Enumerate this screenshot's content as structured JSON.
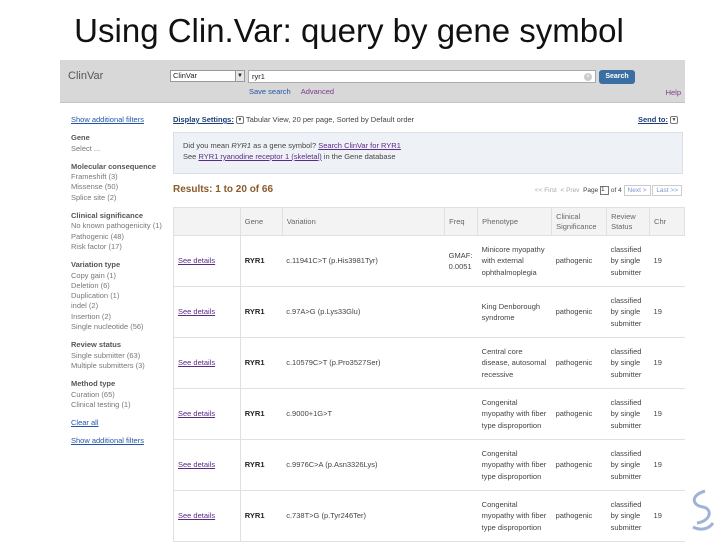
{
  "slide_title": "Using Clin.Var: query by gene symbol",
  "header": {
    "logo": "ClinVar",
    "db_select": "ClinVar",
    "search_value": "ryr1",
    "search_button": "Search",
    "save_search": "Save search",
    "advanced": "Advanced",
    "help": "Help"
  },
  "sidebar": {
    "show_filters_top": "Show additional filters",
    "groups": [
      {
        "title": "Gene",
        "items": [
          "Select ..."
        ]
      },
      {
        "title": "Molecular consequence",
        "items": [
          "Frameshift (3)",
          "Missense (50)",
          "Splice site (2)"
        ]
      },
      {
        "title": "Clinical significance",
        "items": [
          "No known pathogenicity (1)",
          "Pathogenic (48)",
          "Risk factor (17)"
        ]
      },
      {
        "title": "Variation type",
        "items": [
          "Copy gain (1)",
          "Deletion (6)",
          "Duplication (1)",
          "indel (2)",
          "Insertion (2)",
          "Single nucleotide (56)"
        ]
      },
      {
        "title": "Review status",
        "items": [
          "Single submitter (63)",
          "Multiple submitters (3)"
        ]
      },
      {
        "title": "Method type",
        "items": [
          "Curation (65)",
          "Clinical testing (1)"
        ]
      }
    ],
    "clear_all": "Clear all",
    "show_filters_bottom": "Show additional filters"
  },
  "display": {
    "label": "Display Settings:",
    "value": "Tabular View, 20 per page, Sorted by Default order",
    "send_to": "Send to:"
  },
  "suggest": {
    "line1_pre": "Did you mean ",
    "line1_term": "RYR1",
    "line1_mid": " as a gene symbol? ",
    "line1_link": "Search ClinVar for RYR1",
    "line2_pre": "See ",
    "line2_link": "RYR1 ryanodine receptor 1 (skeletal)",
    "line2_post": " in the Gene database"
  },
  "results": {
    "summary": "Results: 1 to 20 of 66",
    "first": "<< First",
    "prev": "< Prev",
    "page_label": "Page",
    "page": "1",
    "of": "of 4",
    "next": "Next >",
    "last": "Last >>"
  },
  "table": {
    "headers": [
      "",
      "Gene",
      "Variation",
      "Freq",
      "Phenotype",
      "Clinical Significance",
      "Review Status",
      "Chr"
    ],
    "rows": [
      {
        "link": "See details",
        "gene": "RYR1",
        "variation": "c.11941C>T (p.His3981Tyr)",
        "freq": "GMAF: 0.0051",
        "phenotype": "Minicore myopathy with external ophthalmoplegia",
        "significance": "pathogenic",
        "review": "classified by single submitter",
        "chr": "19"
      },
      {
        "link": "See details",
        "gene": "RYR1",
        "variation": "c.97A>G (p.Lys33Glu)",
        "freq": "",
        "phenotype": "King Denborough syndrome",
        "significance": "pathogenic",
        "review": "classified by single submitter",
        "chr": "19"
      },
      {
        "link": "See details",
        "gene": "RYR1",
        "variation": "c.10579C>T (p.Pro3527Ser)",
        "freq": "",
        "phenotype": "Central core disease, autosomal recessive",
        "significance": "pathogenic",
        "review": "classified by single submitter",
        "chr": "19"
      },
      {
        "link": "See details",
        "gene": "RYR1",
        "variation": "c.9000+1G>T",
        "freq": "",
        "phenotype": "Congenital myopathy with fiber type disproportion",
        "significance": "pathogenic",
        "review": "classified by single submitter",
        "chr": "19"
      },
      {
        "link": "See details",
        "gene": "RYR1",
        "variation": "c.9976C>A (p.Asn3326Lys)",
        "freq": "",
        "phenotype": "Congenital myopathy with fiber type disproportion",
        "significance": "pathogenic",
        "review": "classified by single submitter",
        "chr": "19"
      },
      {
        "link": "See details",
        "gene": "RYR1",
        "variation": "c.738T>G (p.Tyr246Ter)",
        "freq": "",
        "phenotype": "Congenital myopathy with fiber type disproportion",
        "significance": "pathogenic",
        "review": "classified by single submitter",
        "chr": "19"
      }
    ]
  }
}
